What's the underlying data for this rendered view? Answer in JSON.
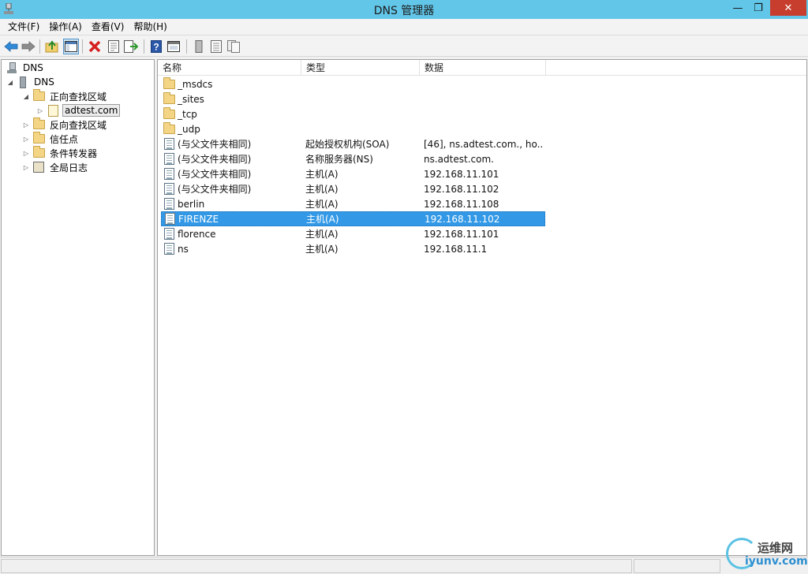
{
  "window": {
    "title": "DNS 管理器",
    "min_label": "—",
    "max_label": "❐",
    "close_label": "✕"
  },
  "menu": [
    {
      "label": "文件(F)"
    },
    {
      "label": "操作(A)"
    },
    {
      "label": "查看(V)"
    },
    {
      "label": "帮助(H)"
    }
  ],
  "toolbar": {
    "buttons": [
      "back-icon",
      "forward-icon",
      "up-folder-icon",
      "show-hide-tree-icon",
      "delete-icon",
      "properties-icon",
      "export-list-icon",
      "help-icon",
      "console-tree-icon",
      "new-record-icon",
      "list-icon",
      "refresh-icon"
    ]
  },
  "tree": {
    "root": "DNS",
    "server": "DNS",
    "forward_zones": "正向查找区域",
    "zone": "adtest.com",
    "reverse_zones": "反向查找区域",
    "trust_points": "信任点",
    "conditional_forwarders": "条件转发器",
    "global_logs": "全局日志"
  },
  "list": {
    "columns": {
      "name": "名称",
      "type": "类型",
      "data": "数据"
    },
    "rows": [
      {
        "name": "_msdcs",
        "type": "",
        "data": "",
        "icon": "folder-icon"
      },
      {
        "name": "_sites",
        "type": "",
        "data": "",
        "icon": "folder-icon"
      },
      {
        "name": "_tcp",
        "type": "",
        "data": "",
        "icon": "folder-icon"
      },
      {
        "name": "_udp",
        "type": "",
        "data": "",
        "icon": "folder-icon"
      },
      {
        "name": "(与父文件夹相同)",
        "type": "起始授权机构(SOA)",
        "data": "[46], ns.adtest.com., ho...",
        "icon": "record-icon"
      },
      {
        "name": "(与父文件夹相同)",
        "type": "名称服务器(NS)",
        "data": "ns.adtest.com.",
        "icon": "record-icon"
      },
      {
        "name": "(与父文件夹相同)",
        "type": "主机(A)",
        "data": "192.168.11.101",
        "icon": "record-icon"
      },
      {
        "name": "(与父文件夹相同)",
        "type": "主机(A)",
        "data": "192.168.11.102",
        "icon": "record-icon"
      },
      {
        "name": "berlin",
        "type": "主机(A)",
        "data": "192.168.11.108",
        "icon": "record-icon"
      },
      {
        "name": "FIRENZE",
        "type": "主机(A)",
        "data": "192.168.11.102",
        "icon": "record-icon",
        "selected": true
      },
      {
        "name": "florence",
        "type": "主机(A)",
        "data": "192.168.11.101",
        "icon": "record-icon"
      },
      {
        "name": "ns",
        "type": "主机(A)",
        "data": "192.168.11.1",
        "icon": "record-icon"
      }
    ]
  },
  "watermark": {
    "top": "运维网",
    "bottom": "iyunv.com"
  },
  "colors": {
    "titlebar": "#62c6e8",
    "close": "#c73e2e",
    "selection": "#3399e6"
  }
}
